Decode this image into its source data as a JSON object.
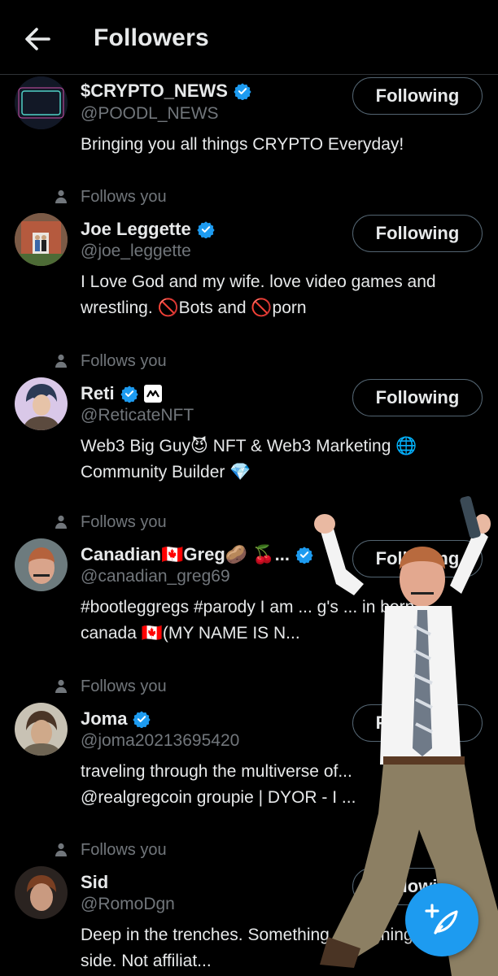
{
  "header": {
    "title": "Followers"
  },
  "follows_you_label": "Follows you",
  "colors": {
    "accent": "#1d9bf0",
    "background": "#000000",
    "muted": "#71767b",
    "text": "#e7e9ea"
  },
  "users": [
    {
      "name": "$CRYPTO_NEWS",
      "handle": "@POODL_NEWS",
      "bio": "Bringing you all things CRYPTO Everyday!",
      "button": "Following",
      "follows_you": false,
      "avatar_text": "CRYPTO NEWS"
    },
    {
      "name": "Joe Leggette",
      "handle": "@joe_leggette",
      "bio": "I Love God and my wife. love video games and wrestling. 🚫Bots and 🚫porn",
      "button": "Following",
      "follows_you": true
    },
    {
      "name": "Reti",
      "handle": "@ReticateNFT",
      "bio": "Web3 Big Guy😈 NFT & Web3 Marketing 🌐 Community Builder 💎",
      "button": "Following",
      "follows_you": true
    },
    {
      "name": "Canadian🇨🇦Greg🥔 🍒...",
      "handle": "@canadian_greg69",
      "bio": "#bootleggregs #parody I am ... g's ... in born canada 🇨🇦(MY NAME IS N...",
      "button": "Following",
      "follows_you": true
    },
    {
      "name": "Joma",
      "handle": "@joma20213695420",
      "bio": "traveling through the multiverse of... @realgregcoin groupie | DYOR - I ...",
      "button": "Following",
      "follows_you": true
    },
    {
      "name": "Sid",
      "handle": "@RomoDgn",
      "bio": "Deep in the trenches. Something something dark side. Not affiliat...",
      "button": "Following",
      "follows_you": true
    }
  ],
  "fab": {
    "icon": "compose-plus-feather-icon"
  }
}
